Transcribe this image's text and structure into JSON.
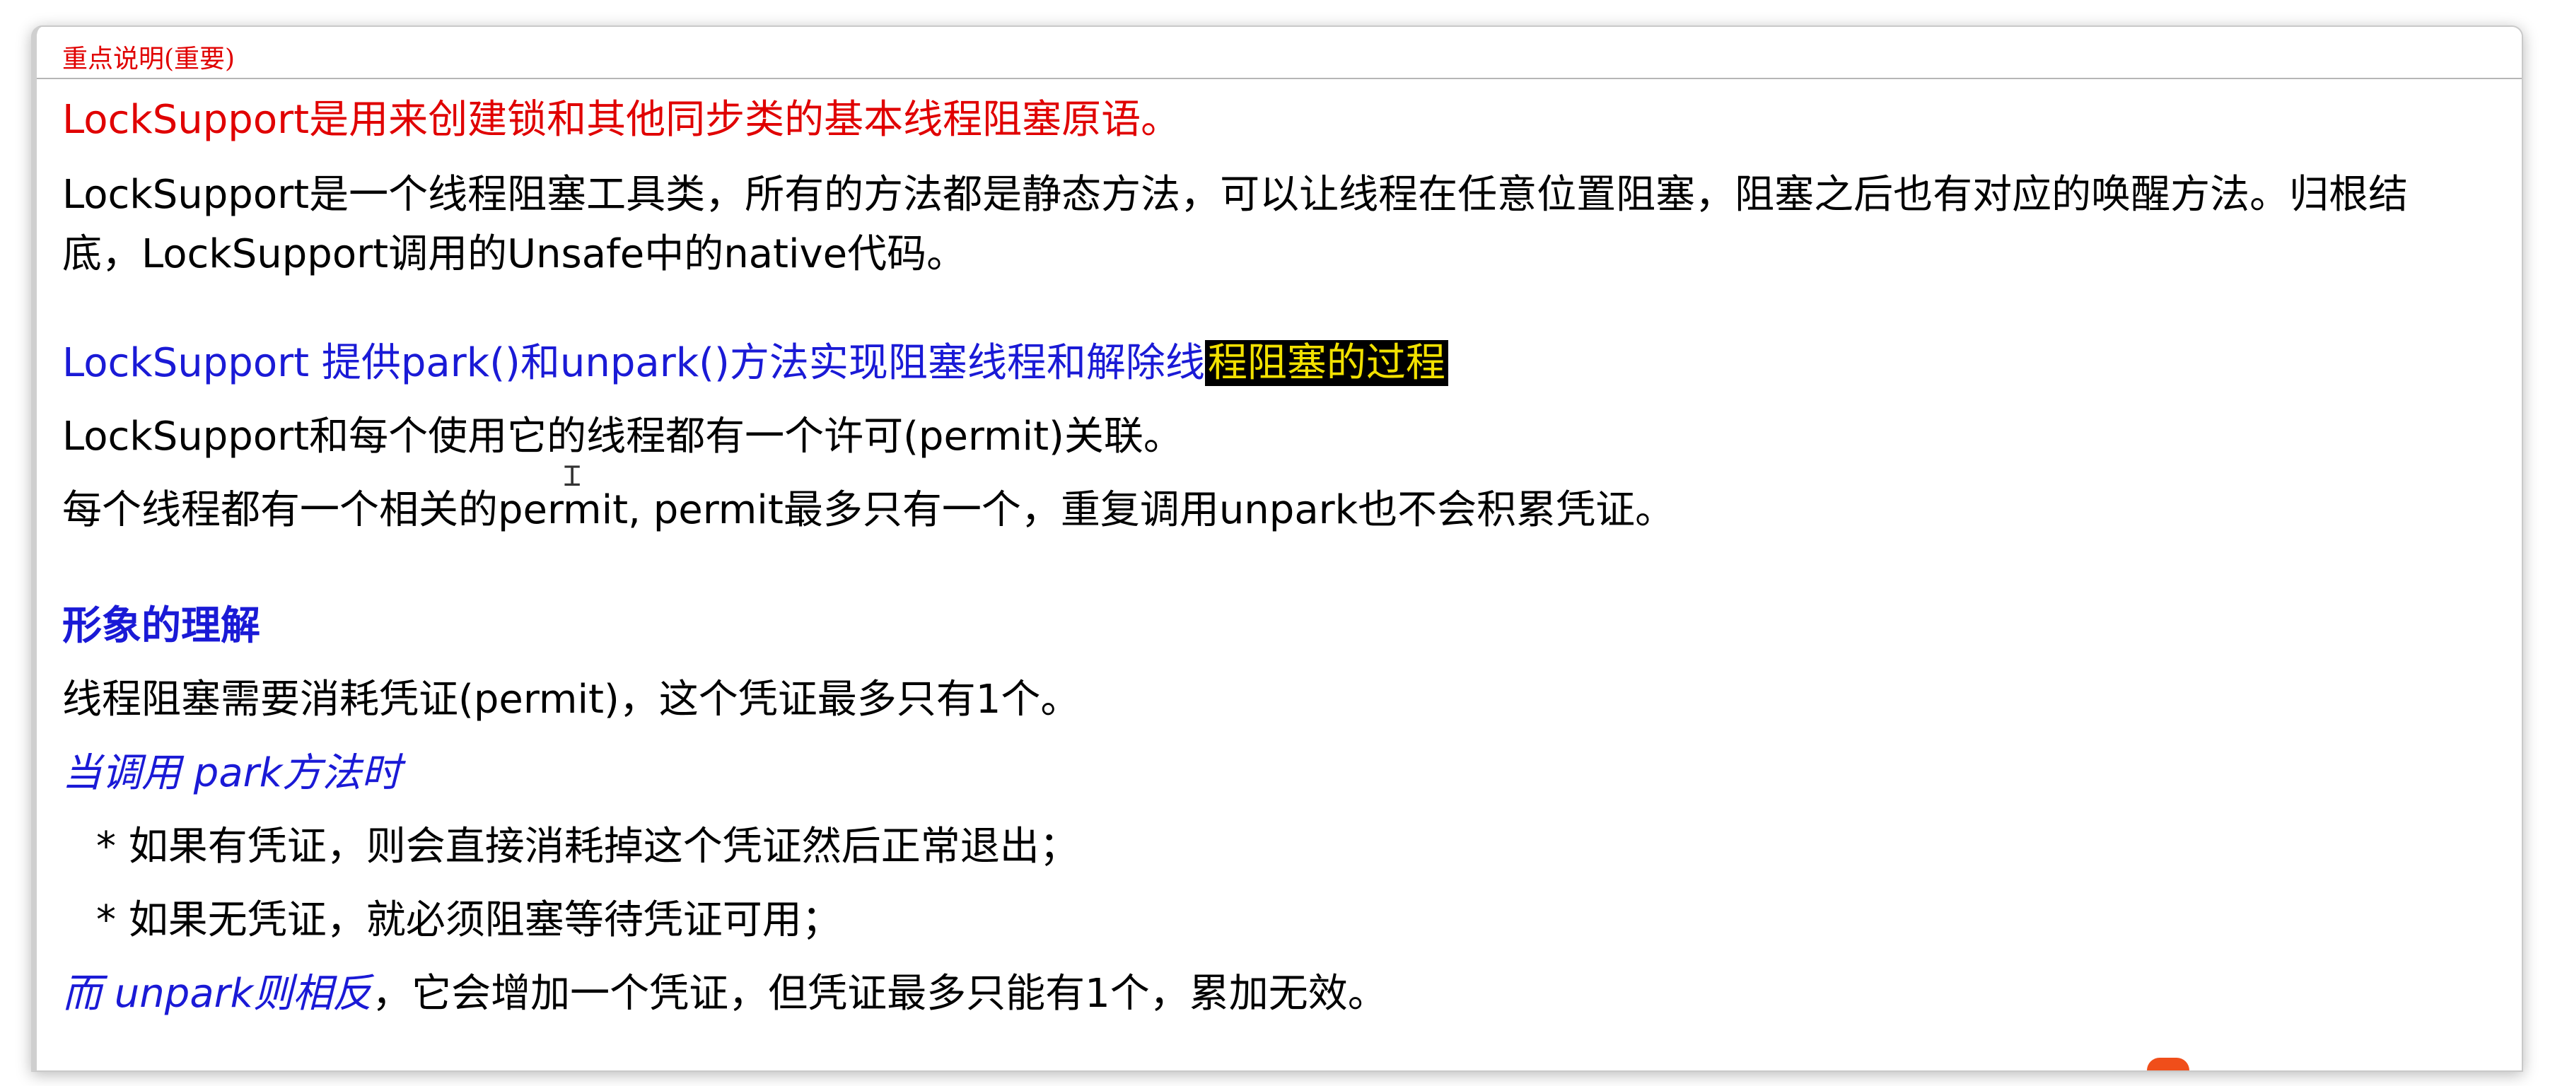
{
  "header": {
    "title": "重点说明(重要)"
  },
  "content": {
    "p1": "LockSupport是用来创建锁和其他同步类的基本线程阻塞原语。",
    "p2_line1": "LockSupport是一个线程阻塞工具类，所有的方法都是静态方法，可以让线程在任意位置阻塞，阻塞之后也有对应的唤醒方法。归根结",
    "p2_line2": "底，LockSupport调用的Unsafe中的native代码。",
    "p3_main": "LockSupport 提供park()和unpark()方法实现阻塞线程和解除线",
    "p3_highlight": "程阻塞的过程",
    "p4": "LockSupport和每个使用它的线程都有一个许可(permit)关联。",
    "p5": "每个线程都有一个相关的permit, permit最多只有一个，重复调用unpark也不会积累凭证。",
    "h1": "形象的理解",
    "p6": "线程阻塞需要消耗凭证(permit)，这个凭证最多只有1个。",
    "p7": "当调用 park方法时",
    "b1": "* 如果有凭证，则会直接消耗掉这个凭证然后正常退出；",
    "b2": "* 如果无凭证，就必须阻塞等待凭证可用；",
    "p8_italic": "而 unpark则相反",
    "p8_rest": "，它会增加一个凭证，但凭证最多只能有1个，累加无效。"
  },
  "colors": {
    "red": "#e00000",
    "blue": "#1a1ad6",
    "highlight_bg": "#000000",
    "highlight_fg": "#f2e100"
  },
  "icons": {
    "cursor": "text-cursor-icon"
  }
}
